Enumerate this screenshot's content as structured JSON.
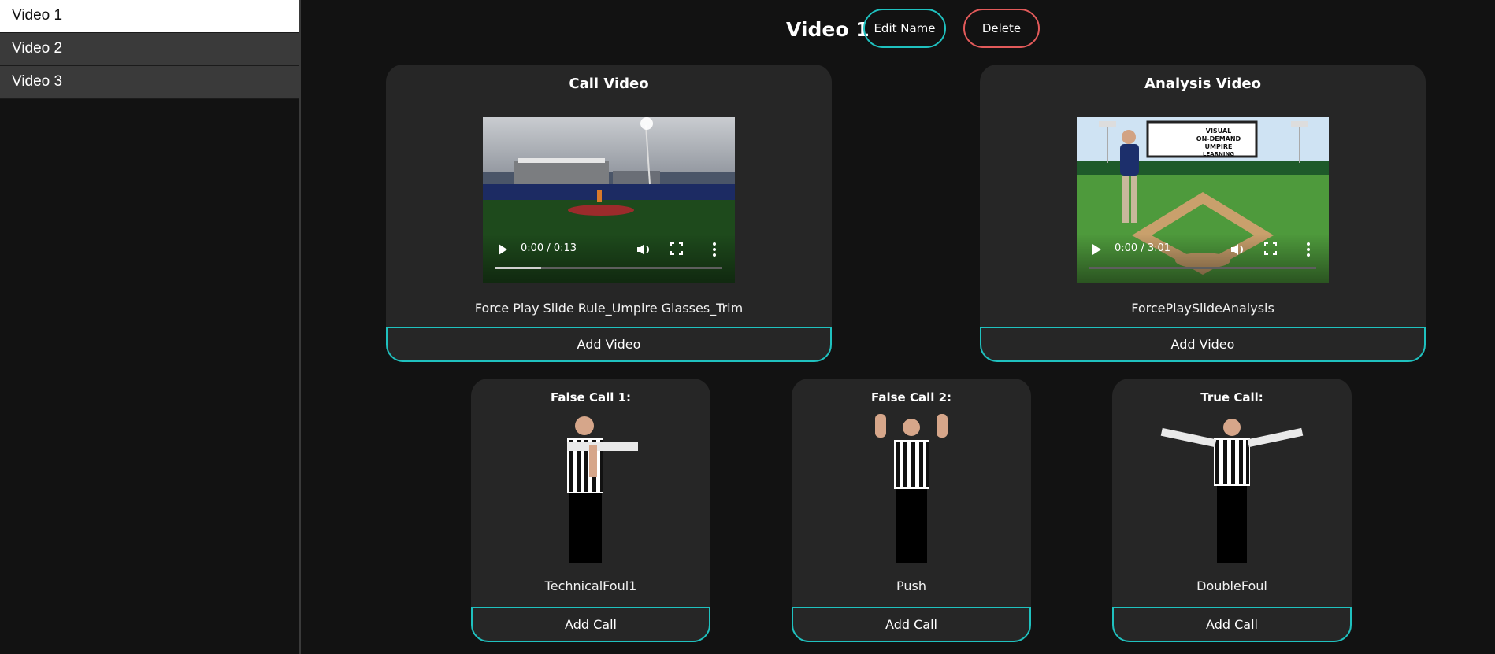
{
  "sidebar": {
    "items": [
      {
        "label": "Video 1",
        "active": true
      },
      {
        "label": "Video 2",
        "active": false
      },
      {
        "label": "Video 3",
        "active": false
      }
    ]
  },
  "header": {
    "title": "Video 1",
    "edit_label": "Edit Name",
    "delete_label": "Delete"
  },
  "call_video": {
    "title": "Call Video",
    "time": "0:00 / 0:13",
    "progress_fraction": 0.2,
    "caption": "Force Play Slide Rule_Umpire Glasses_Trim",
    "button": "Add Video"
  },
  "analysis_video": {
    "title": "Analysis Video",
    "time": "0:00 / 3:01",
    "progress_fraction": 0.0,
    "caption": "ForcePlaySlideAnalysis",
    "button": "Add Video",
    "billboard_text": "VISUAL ON-DEMAND UMPIRE LEARNING"
  },
  "calls": [
    {
      "title": "False Call 1:",
      "caption": "TechnicalFoul1",
      "button": "Add Call"
    },
    {
      "title": "False Call 2:",
      "caption": "Push",
      "button": "Add Call"
    },
    {
      "title": "True Call:",
      "caption": "DoubleFoul",
      "button": "Add Call"
    }
  ],
  "colors": {
    "accent": "#1fc1bf",
    "danger": "#e25a5a",
    "card": "#262626",
    "background": "#121212"
  }
}
